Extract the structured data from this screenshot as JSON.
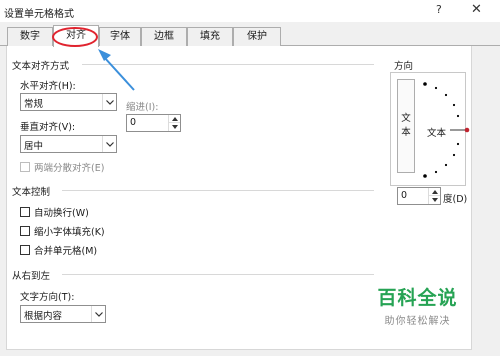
{
  "dialog": {
    "title": "设置单元格格式",
    "help_label": "?",
    "close_label": "✕"
  },
  "tabs": [
    {
      "label": "数字"
    },
    {
      "label": "对齐"
    },
    {
      "label": "字体"
    },
    {
      "label": "边框"
    },
    {
      "label": "填充"
    },
    {
      "label": "保护"
    }
  ],
  "active_tab": "对齐",
  "text_alignment": {
    "section_title": "文本对齐方式",
    "horizontal_label": "水平对齐(H):",
    "horizontal_value": "常规",
    "indent_label": "缩进(I):",
    "indent_value": "0",
    "vertical_label": "垂直对齐(V):",
    "vertical_value": "居中",
    "justify_distributed_label": "两端分散对齐(E)"
  },
  "text_control": {
    "section_title": "文本控制",
    "wrap_text_label": "自动换行(W)",
    "shrink_to_fit_label": "缩小字体填充(K)",
    "merge_cells_label": "合并单元格(M)"
  },
  "right_to_left": {
    "section_title": "从右到左",
    "direction_label": "文字方向(T):",
    "direction_value": "根据内容"
  },
  "orientation": {
    "section_title": "方向",
    "vertical_text_chars": [
      "文",
      "本"
    ],
    "dial_label": "文本",
    "degrees_value": "0",
    "degrees_label": "度(D)"
  },
  "watermark": {
    "brand": "百科全说",
    "tagline": "助你轻松解决"
  },
  "colors": {
    "highlight": "#e0242f",
    "arrow": "#3b8fdb",
    "watermark": "#26a354",
    "accent_dot": "#c0242f"
  },
  "icons": {
    "dropdown": "chevron-down-icon",
    "spin_up": "spin-up-icon",
    "spin_down": "spin-down-icon"
  }
}
